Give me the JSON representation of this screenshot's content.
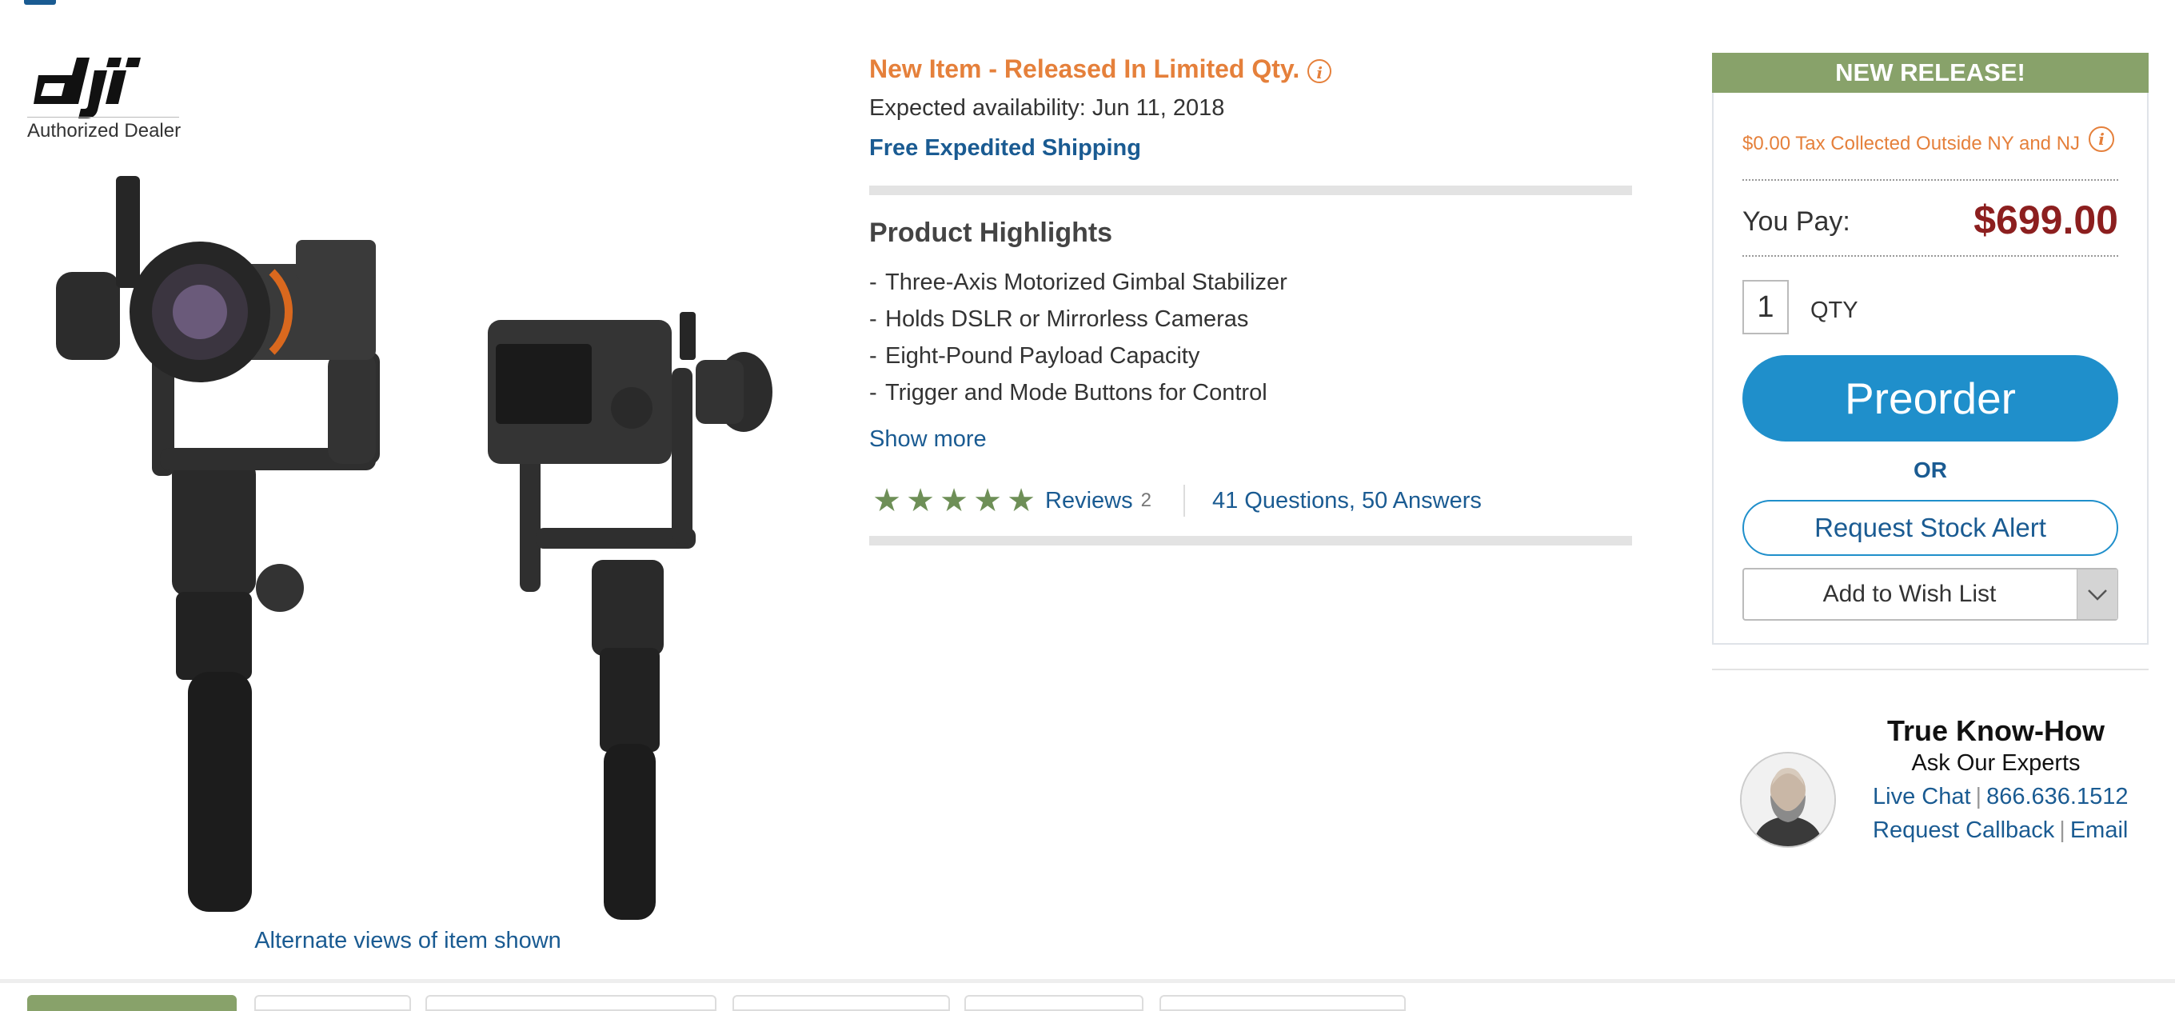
{
  "brand": {
    "logo_text": "dji",
    "dealer_label": "Authorized Dealer"
  },
  "gallery": {
    "alt_views_label": "Alternate views of item shown"
  },
  "product": {
    "status_label": "New Item - Released In Limited Qty.",
    "availability": "Expected availability: Jun 11, 2018",
    "shipping": "Free Expedited Shipping",
    "highlights_title": "Product Highlights",
    "highlights": [
      "Three-Axis Motorized Gimbal Stabilizer",
      "Holds DSLR or Mirrorless Cameras",
      "Eight-Pound Payload Capacity",
      "Trigger and Mode Buttons for Control"
    ],
    "show_more": "Show more",
    "rating_stars": 5,
    "reviews_label": "Reviews",
    "reviews_count": "2",
    "qa_label": "41 Questions, 50 Answers"
  },
  "buy_box": {
    "banner": "NEW RELEASE!",
    "tax_note": "$0.00 Tax Collected Outside NY and NJ",
    "you_pay_label": "You Pay:",
    "price": "$699.00",
    "qty_value": "1",
    "qty_label": "QTY",
    "preorder_label": "Preorder",
    "or_label": "OR",
    "stock_alert_label": "Request Stock Alert",
    "wishlist_label": "Add to Wish List"
  },
  "experts": {
    "title": "True Know-How",
    "subtitle": "Ask Our Experts",
    "live_chat": "Live Chat",
    "phone": "866.636.1512",
    "callback": "Request Callback",
    "email": "Email"
  },
  "colors": {
    "accent_orange": "#e5803b",
    "link_blue": "#1a5b92",
    "button_blue": "#1f8fcb",
    "banner_green": "#88a26a",
    "price_red": "#8c1f1f",
    "star_green": "#6e8f57"
  }
}
